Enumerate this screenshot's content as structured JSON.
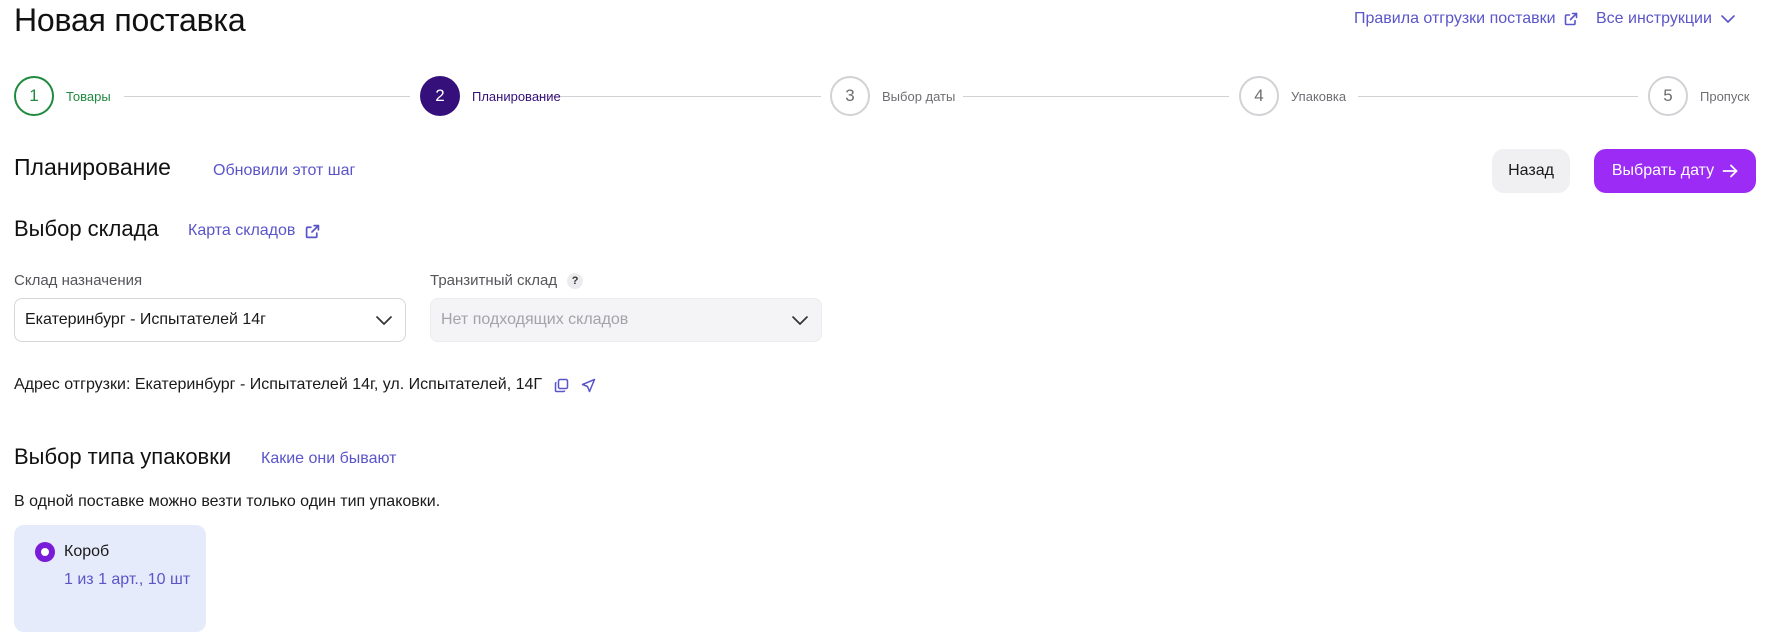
{
  "header": {
    "title": "Новая поставка",
    "rules_link": "Правила отгрузки поставки",
    "instructions_link": "Все инструкции"
  },
  "stepper": [
    {
      "number": "1",
      "label": "Товары",
      "state": "done"
    },
    {
      "number": "2",
      "label": "Планирование",
      "state": "active"
    },
    {
      "number": "3",
      "label": "Выбор даты",
      "state": "pending"
    },
    {
      "number": "4",
      "label": "Упаковка",
      "state": "pending"
    },
    {
      "number": "5",
      "label": "Пропуск",
      "state": "pending"
    }
  ],
  "planning": {
    "title": "Планирование",
    "updated_link": "Обновили этот шаг",
    "back_button": "Назад",
    "next_button": "Выбрать дату"
  },
  "warehouse": {
    "title": "Выбор склада",
    "map_link": "Карта складов",
    "destination_label": "Склад назначения",
    "destination_value": "Екатеринбург - Испытателей 14г",
    "transit_label": "Транзитный склад",
    "transit_help": "?",
    "transit_placeholder": "Нет подходящих складов",
    "address": "Адрес отгрузки: Екатеринбург - Испытателей 14г, ул. Испытателей, 14Г"
  },
  "packaging": {
    "title": "Выбор типа упаковки",
    "types_link": "Какие они бывают",
    "note": "В одной поставке можно везти только один тип упаковки.",
    "option_name": "Короб",
    "option_count": "1 из 1 арт., 10 шт"
  },
  "colors": {
    "accent": "#9b2bf5",
    "active_step": "#35107a",
    "done_step": "#1f8a3d",
    "link": "#5a55c9",
    "card_bg": "#e5ebfb"
  },
  "icons": [
    "external-link-icon",
    "chevron-down-icon",
    "arrow-right-icon",
    "help-icon",
    "copy-icon",
    "navigation-arrow-icon",
    "radio-selected-icon"
  ]
}
